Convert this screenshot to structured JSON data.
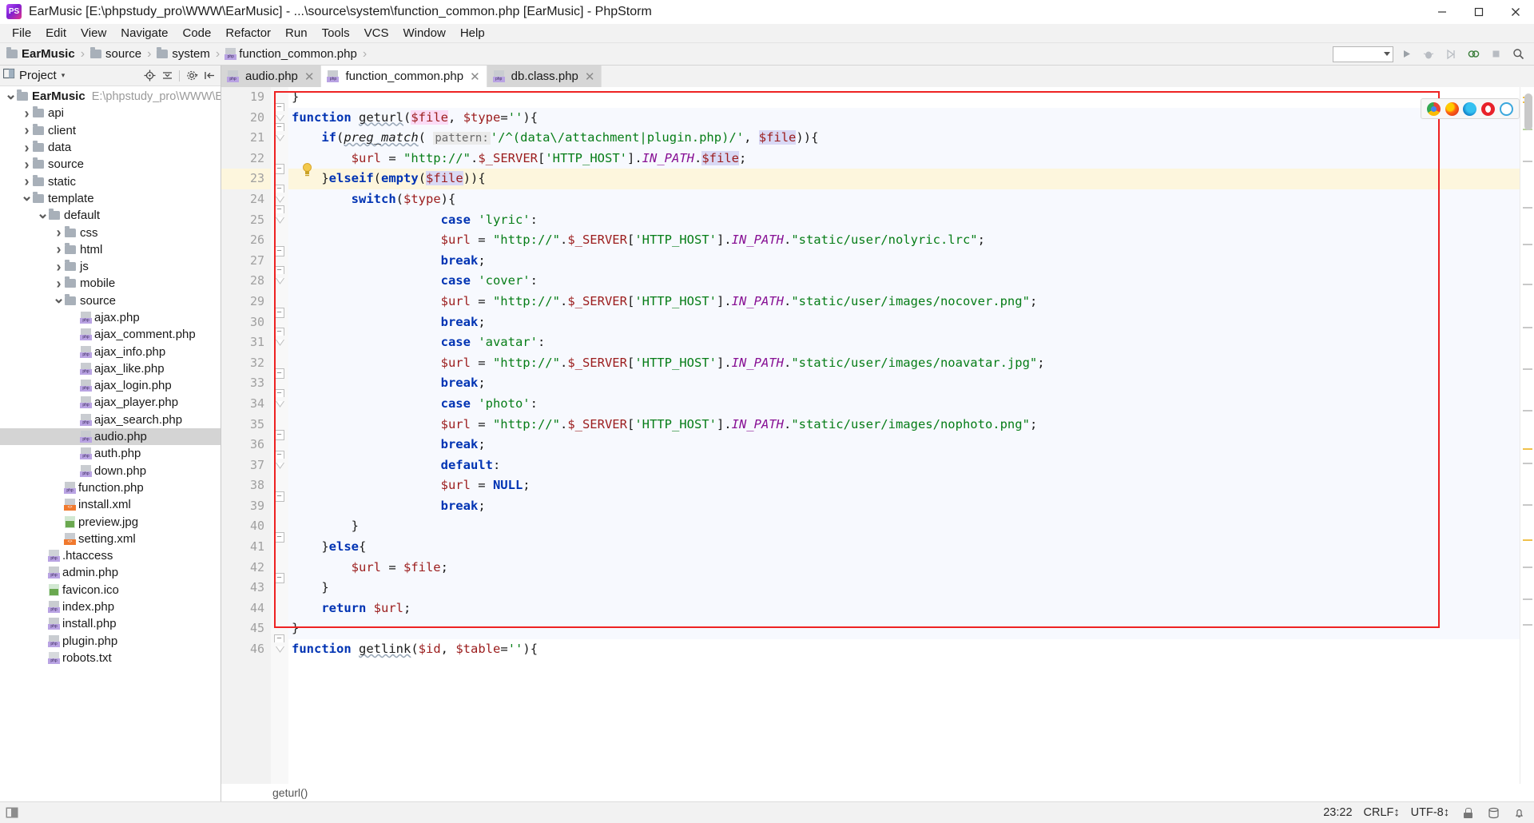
{
  "window": {
    "title": "EarMusic [E:\\phpstudy_pro\\WWW\\EarMusic] - ...\\source\\system\\function_common.php [EarMusic] - PhpStorm",
    "app_icon": "phpstorm-icon",
    "minimize": "—",
    "maximize": "□",
    "close": "✕"
  },
  "menubar": {
    "items": [
      {
        "label": "File"
      },
      {
        "label": "Edit"
      },
      {
        "label": "View"
      },
      {
        "label": "Navigate"
      },
      {
        "label": "Code"
      },
      {
        "label": "Refactor"
      },
      {
        "label": "Run"
      },
      {
        "label": "Tools"
      },
      {
        "label": "VCS"
      },
      {
        "label": "Window"
      },
      {
        "label": "Help"
      }
    ]
  },
  "breadcrumb": {
    "items": [
      {
        "label": "EarMusic",
        "icon": "folder-icon",
        "bold": true
      },
      {
        "label": "source",
        "icon": "folder-icon",
        "bold": false
      },
      {
        "label": "system",
        "icon": "folder-icon",
        "bold": false
      },
      {
        "label": "function_common.php",
        "icon": "php-file-icon",
        "bold": false
      }
    ],
    "separator": "›"
  },
  "toolbar_right": {
    "run_config": "",
    "run_icon": "run-icon",
    "debug_icon": "debug-icon",
    "coverage_icon": "coverage-icon",
    "profile_icon": "profile-icon",
    "stop_icon": "stop-icon",
    "search_icon": "search-icon"
  },
  "project_panel": {
    "title": "Project",
    "caret": "▾",
    "tools": [
      "locate-icon",
      "collapse-all-icon",
      "settings-icon",
      "hide-icon"
    ],
    "tree": [
      {
        "indent": 0,
        "chev": "down",
        "icon": "folder-icon",
        "label": "EarMusic",
        "bold": true,
        "sub": "E:\\phpstudy_pro\\WWW\\EarM",
        "selected": false
      },
      {
        "indent": 1,
        "chev": "right",
        "icon": "folder-icon",
        "label": "api",
        "bold": false,
        "sub": "",
        "selected": false
      },
      {
        "indent": 1,
        "chev": "right",
        "icon": "folder-icon",
        "label": "client",
        "bold": false,
        "sub": "",
        "selected": false
      },
      {
        "indent": 1,
        "chev": "right",
        "icon": "folder-icon",
        "label": "data",
        "bold": false,
        "sub": "",
        "selected": false
      },
      {
        "indent": 1,
        "chev": "right",
        "icon": "folder-icon",
        "label": "source",
        "bold": false,
        "sub": "",
        "selected": false
      },
      {
        "indent": 1,
        "chev": "right",
        "icon": "folder-icon",
        "label": "static",
        "bold": false,
        "sub": "",
        "selected": false
      },
      {
        "indent": 1,
        "chev": "down",
        "icon": "folder-icon",
        "label": "template",
        "bold": false,
        "sub": "",
        "selected": false
      },
      {
        "indent": 2,
        "chev": "down",
        "icon": "folder-icon",
        "label": "default",
        "bold": false,
        "sub": "",
        "selected": false
      },
      {
        "indent": 3,
        "chev": "right",
        "icon": "folder-icon",
        "label": "css",
        "bold": false,
        "sub": "",
        "selected": false
      },
      {
        "indent": 3,
        "chev": "right",
        "icon": "folder-icon",
        "label": "html",
        "bold": false,
        "sub": "",
        "selected": false
      },
      {
        "indent": 3,
        "chev": "right",
        "icon": "folder-icon",
        "label": "js",
        "bold": false,
        "sub": "",
        "selected": false
      },
      {
        "indent": 3,
        "chev": "right",
        "icon": "folder-icon",
        "label": "mobile",
        "bold": false,
        "sub": "",
        "selected": false
      },
      {
        "indent": 3,
        "chev": "down",
        "icon": "folder-icon",
        "label": "source",
        "bold": false,
        "sub": "",
        "selected": false
      },
      {
        "indent": 4,
        "chev": "none",
        "icon": "php-file-icon",
        "label": "ajax.php",
        "bold": false,
        "sub": "",
        "selected": false
      },
      {
        "indent": 4,
        "chev": "none",
        "icon": "php-file-icon",
        "label": "ajax_comment.php",
        "bold": false,
        "sub": "",
        "selected": false
      },
      {
        "indent": 4,
        "chev": "none",
        "icon": "php-file-icon",
        "label": "ajax_info.php",
        "bold": false,
        "sub": "",
        "selected": false
      },
      {
        "indent": 4,
        "chev": "none",
        "icon": "php-file-icon",
        "label": "ajax_like.php",
        "bold": false,
        "sub": "",
        "selected": false
      },
      {
        "indent": 4,
        "chev": "none",
        "icon": "php-file-icon",
        "label": "ajax_login.php",
        "bold": false,
        "sub": "",
        "selected": false
      },
      {
        "indent": 4,
        "chev": "none",
        "icon": "php-file-icon",
        "label": "ajax_player.php",
        "bold": false,
        "sub": "",
        "selected": false
      },
      {
        "indent": 4,
        "chev": "none",
        "icon": "php-file-icon",
        "label": "ajax_search.php",
        "bold": false,
        "sub": "",
        "selected": false
      },
      {
        "indent": 4,
        "chev": "none",
        "icon": "php-file-icon",
        "label": "audio.php",
        "bold": false,
        "sub": "",
        "selected": true
      },
      {
        "indent": 4,
        "chev": "none",
        "icon": "php-file-icon",
        "label": "auth.php",
        "bold": false,
        "sub": "",
        "selected": false
      },
      {
        "indent": 4,
        "chev": "none",
        "icon": "php-file-icon",
        "label": "down.php",
        "bold": false,
        "sub": "",
        "selected": false
      },
      {
        "indent": 3,
        "chev": "none",
        "icon": "php-file-icon",
        "label": "function.php",
        "bold": false,
        "sub": "",
        "selected": false
      },
      {
        "indent": 3,
        "chev": "none",
        "icon": "xml-file-icon",
        "label": "install.xml",
        "bold": false,
        "sub": "",
        "selected": false
      },
      {
        "indent": 3,
        "chev": "none",
        "icon": "image-file-icon",
        "label": "preview.jpg",
        "bold": false,
        "sub": "",
        "selected": false
      },
      {
        "indent": 3,
        "chev": "none",
        "icon": "xml-file-icon",
        "label": "setting.xml",
        "bold": false,
        "sub": "",
        "selected": false
      },
      {
        "indent": 2,
        "chev": "none",
        "icon": "htaccess-file-icon",
        "label": ".htaccess",
        "bold": false,
        "sub": "",
        "selected": false
      },
      {
        "indent": 2,
        "chev": "none",
        "icon": "php-file-icon",
        "label": "admin.php",
        "bold": false,
        "sub": "",
        "selected": false
      },
      {
        "indent": 2,
        "chev": "none",
        "icon": "ico-file-icon",
        "label": "favicon.ico",
        "bold": false,
        "sub": "",
        "selected": false
      },
      {
        "indent": 2,
        "chev": "none",
        "icon": "php-file-icon",
        "label": "index.php",
        "bold": false,
        "sub": "",
        "selected": false
      },
      {
        "indent": 2,
        "chev": "none",
        "icon": "php-file-icon",
        "label": "install.php",
        "bold": false,
        "sub": "",
        "selected": false
      },
      {
        "indent": 2,
        "chev": "none",
        "icon": "php-file-icon",
        "label": "plugin.php",
        "bold": false,
        "sub": "",
        "selected": false
      },
      {
        "indent": 2,
        "chev": "none",
        "icon": "txt-file-icon",
        "label": "robots.txt",
        "bold": false,
        "sub": "",
        "selected": false
      }
    ]
  },
  "tabs": [
    {
      "label": "audio.php",
      "icon": "php-file-icon",
      "state": "active",
      "close": "✕"
    },
    {
      "label": "function_common.php",
      "icon": "php-file-icon",
      "state": "current",
      "close": "✕"
    },
    {
      "label": "db.class.php",
      "icon": "php-file-icon",
      "state": "inactive",
      "close": "✕"
    }
  ],
  "editor": {
    "first_line": 19,
    "highlighted_line": 23,
    "caret_line": 21,
    "status_breadcrumb": "geturl()",
    "line_numbers": [
      19,
      20,
      21,
      22,
      23,
      24,
      25,
      26,
      27,
      28,
      29,
      30,
      31,
      32,
      33,
      34,
      35,
      36,
      37,
      38,
      39,
      40,
      41,
      42,
      43,
      44,
      45,
      46
    ],
    "lines": [
      {
        "n": 19,
        "text": "}"
      },
      {
        "n": 20,
        "text": "function geturl($file, $type=''){"
      },
      {
        "n": 21,
        "text": "    if(preg_match( pattern: '/^(data\\/attachment|plugin.php)/', $file)){"
      },
      {
        "n": 22,
        "text": "        $url = \"http://\".$_SERVER['HTTP_HOST'].IN_PATH.$file;"
      },
      {
        "n": 23,
        "text": "    }elseif(empty($file)){"
      },
      {
        "n": 24,
        "text": "        switch($type){"
      },
      {
        "n": 25,
        "text": "                    case 'lyric':"
      },
      {
        "n": 26,
        "text": "                    $url = \"http://\".$_SERVER['HTTP_HOST'].IN_PATH.\"static/user/nolyric.lrc\";"
      },
      {
        "n": 27,
        "text": "                    break;"
      },
      {
        "n": 28,
        "text": "                    case 'cover':"
      },
      {
        "n": 29,
        "text": "                    $url = \"http://\".$_SERVER['HTTP_HOST'].IN_PATH.\"static/user/images/nocover.png\";"
      },
      {
        "n": 30,
        "text": "                    break;"
      },
      {
        "n": 31,
        "text": "                    case 'avatar':"
      },
      {
        "n": 32,
        "text": "                    $url = \"http://\".$_SERVER['HTTP_HOST'].IN_PATH.\"static/user/images/noavatar.jpg\";"
      },
      {
        "n": 33,
        "text": "                    break;"
      },
      {
        "n": 34,
        "text": "                    case 'photo':"
      },
      {
        "n": 35,
        "text": "                    $url = \"http://\".$_SERVER['HTTP_HOST'].IN_PATH.\"static/user/images/nophoto.png\";"
      },
      {
        "n": 36,
        "text": "                    break;"
      },
      {
        "n": 37,
        "text": "                    default:"
      },
      {
        "n": 38,
        "text": "                    $url = NULL;"
      },
      {
        "n": 39,
        "text": "                    break;"
      },
      {
        "n": 40,
        "text": "        }"
      },
      {
        "n": 41,
        "text": "    }else{"
      },
      {
        "n": 42,
        "text": "        $url = $file;"
      },
      {
        "n": 43,
        "text": "    }"
      },
      {
        "n": 44,
        "text": "    return $url;"
      },
      {
        "n": 45,
        "text": "}"
      },
      {
        "n": 46,
        "text": "function getlink($id, $table=''){"
      }
    ],
    "inlay_hint": "pattern:",
    "bulb_icon": "intention-bulb-icon",
    "browser_icons": [
      "chrome-icon",
      "firefox-icon",
      "edge-icon",
      "opera-icon",
      "ie-icon"
    ],
    "annotation_box_color": "#ee2222"
  },
  "statusbar": {
    "menu_icon": "show-tool-windows-icon",
    "time": "23:22",
    "line_separator": "CRLF↕",
    "encoding": "UTF-8↕",
    "lock_icon": "read-only-lock-icon",
    "database_icon": "database-icon",
    "notification_icon": "notifications-icon"
  },
  "colors": {
    "keyword": "#0033b3",
    "string": "#067d17",
    "variable": "#871094",
    "constant": "#871094",
    "annotation": "#ee2222",
    "highlight_line": "#fdf6dd",
    "selection": "#d4d4d4"
  }
}
